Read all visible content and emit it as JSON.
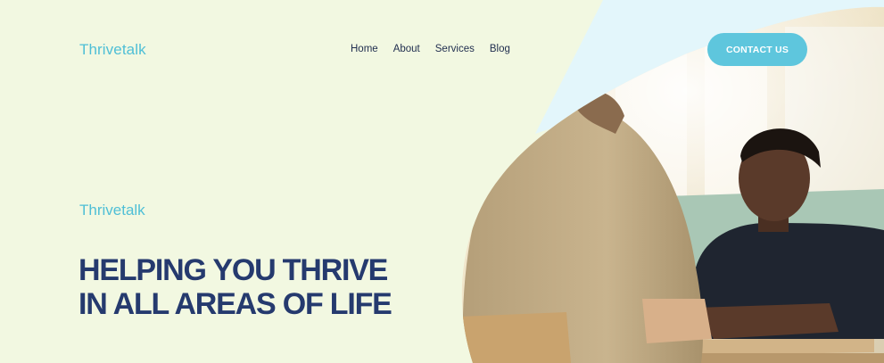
{
  "header": {
    "brand": "Thrivetalk",
    "nav": [
      "Home",
      "About",
      "Services",
      "Blog"
    ],
    "cta_label": "CONTACT US"
  },
  "hero": {
    "eyebrow": "Thrivetalk",
    "headline_line1": "HELPING YOU THRIVE",
    "headline_line2": "IN ALL AREAS OF LIFE"
  },
  "colors": {
    "background": "#f2f8e1",
    "accent": "#5ec6dd",
    "heading": "#253a6e",
    "nav_text": "#1f2d4e",
    "stripe": "#e3f6fb"
  }
}
